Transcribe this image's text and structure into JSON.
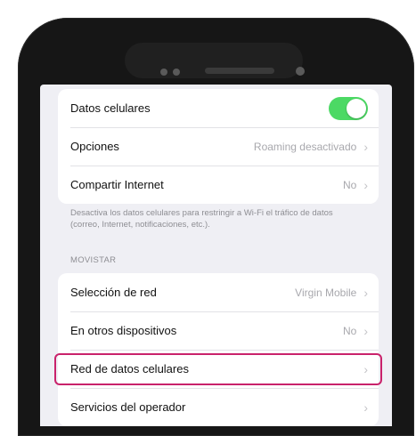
{
  "cellular": {
    "datos_label": "Datos celulares",
    "datos_on": true,
    "toggle_color": "#4cd964",
    "opciones_label": "Opciones",
    "opciones_value": "Roaming desactivado",
    "compartir_label": "Compartir Internet",
    "compartir_value": "No",
    "note": "Desactiva los datos celulares para restringir a Wi-Fi el tráfico de datos (correo, Internet, notificaciones, etc.).",
    "carrier_header": "MOVISTAR",
    "seleccion_label": "Selección de red",
    "seleccion_value": "Virgin Mobile",
    "otros_label": "En otros dispositivos",
    "otros_value": "No",
    "red_label": "Red de datos celulares",
    "servicios_label": "Servicios del operador",
    "highlight_color": "#c9226b"
  },
  "icons": {
    "chevron": "chevron-right-icon"
  }
}
